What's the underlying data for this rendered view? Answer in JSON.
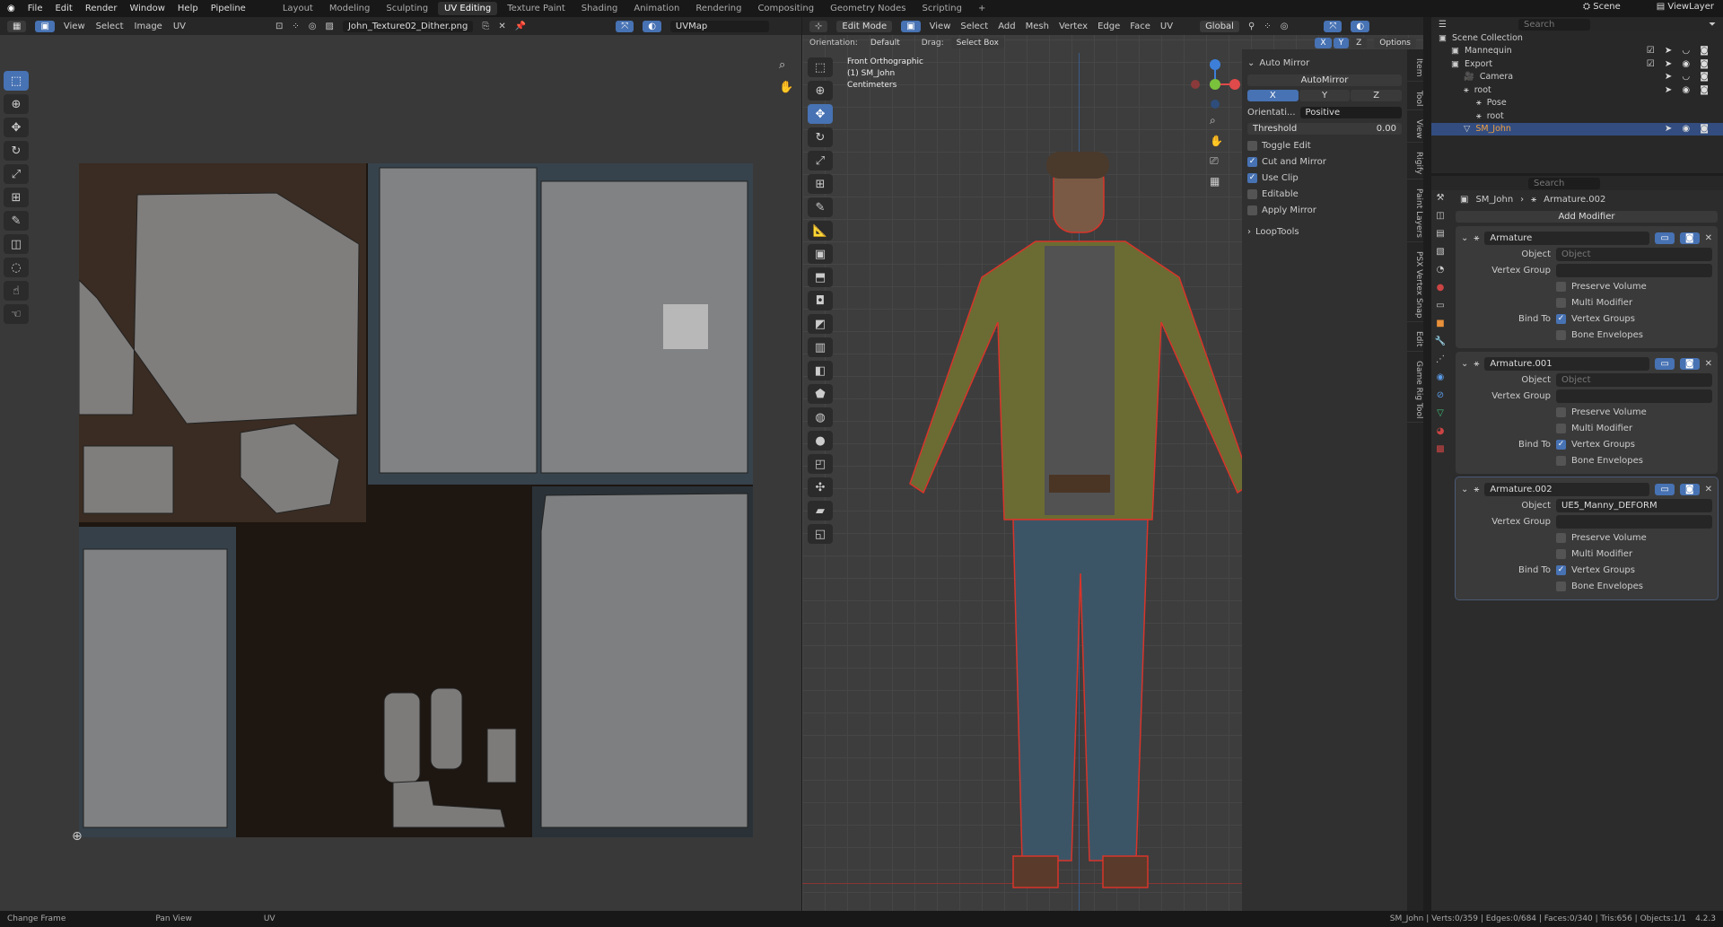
{
  "menu": [
    "File",
    "Edit",
    "Render",
    "Window",
    "Help",
    "Pipeline"
  ],
  "workspaces": [
    "Layout",
    "Modeling",
    "Sculpting",
    "UV Editing",
    "Texture Paint",
    "Shading",
    "Animation",
    "Rendering",
    "Compositing",
    "Geometry Nodes",
    "Scripting",
    "+"
  ],
  "active_workspace": "UV Editing",
  "scene": {
    "scene_label": "Scene",
    "view_layer_label": "ViewLayer"
  },
  "uv_header": {
    "menus": [
      "View",
      "Select",
      "Image",
      "UV"
    ],
    "image_name": "John_Texture02_Dither.png",
    "uv_map": "UVMap"
  },
  "vp_header": {
    "mode": "Edit Mode",
    "menus": [
      "View",
      "Select",
      "Add",
      "Mesh",
      "Vertex",
      "Edge",
      "Face",
      "UV"
    ],
    "transform": "Global",
    "orientation_label": "Orientation:",
    "orientation": "Default",
    "drag_label": "Drag:",
    "drag": "Select Box",
    "axes": [
      "X",
      "Y",
      "Z"
    ],
    "options": "Options"
  },
  "viewport_info": {
    "view": "Front Orthographic",
    "object": "(1) SM_John",
    "units": "Centimeters"
  },
  "npanel": {
    "auto_mirror_title": "Auto Mirror",
    "automirror_button": "AutoMirror",
    "axes": [
      "X",
      "Y",
      "Z"
    ],
    "orientation_label": "Orientati...",
    "orientation_value": "Positive",
    "threshold_label": "Threshold",
    "threshold_value": "0.00",
    "options": [
      {
        "label": "Toggle Edit",
        "checked": false
      },
      {
        "label": "Cut and Mirror",
        "checked": true
      },
      {
        "label": "Use Clip",
        "checked": true
      },
      {
        "label": "Editable",
        "checked": false
      },
      {
        "label": "Apply Mirror",
        "checked": false
      }
    ],
    "looptools_title": "LoopTools"
  },
  "side_tabs": [
    "Item",
    "Tool",
    "View",
    "Rigify",
    "Paint Layers",
    "PSX Vertex Snap",
    "Edit",
    "Game Rig Tool"
  ],
  "outliner": {
    "search_placeholder": "Search",
    "items": [
      {
        "label": "Scene Collection",
        "indent": 0,
        "vis": ""
      },
      {
        "label": "Mannequin",
        "indent": 1,
        "vis": "☑ ➤ ◡ ◙"
      },
      {
        "label": "Export",
        "indent": 1,
        "vis": "☑ ➤ ◉ ◙"
      },
      {
        "label": "Camera",
        "indent": 2,
        "vis": "➤ ◡ ◙"
      },
      {
        "label": "root",
        "indent": 2,
        "vis": "➤ ◉ ◙"
      },
      {
        "label": "Pose",
        "indent": 3,
        "vis": ""
      },
      {
        "label": "root",
        "indent": 3,
        "vis": ""
      },
      {
        "label": "SM_John",
        "indent": 2,
        "vis": "➤ ◉ ◙",
        "selected": true
      }
    ]
  },
  "properties": {
    "search_placeholder": "Search",
    "breadcrumb": [
      "SM_John",
      "Armature.002"
    ],
    "add_modifier": "Add Modifier",
    "modifiers": [
      {
        "name": "Armature",
        "object_label": "Object",
        "object": "Object",
        "object_set": false,
        "vg_label": "Vertex Group",
        "preserve_volume": "Preserve Volume",
        "multi_modifier": "Multi Modifier",
        "bind_label": "Bind To",
        "vertex_groups": "Vertex Groups",
        "bone_envelopes": "Bone Envelopes"
      },
      {
        "name": "Armature.001",
        "object_label": "Object",
        "object": "Object",
        "object_set": false,
        "vg_label": "Vertex Group",
        "preserve_volume": "Preserve Volume",
        "multi_modifier": "Multi Modifier",
        "bind_label": "Bind To",
        "vertex_groups": "Vertex Groups",
        "bone_envelopes": "Bone Envelopes"
      },
      {
        "name": "Armature.002",
        "object_label": "Object",
        "object": "UE5_Manny_DEFORM",
        "object_set": true,
        "vg_label": "Vertex Group",
        "preserve_volume": "Preserve Volume",
        "multi_modifier": "Multi Modifier",
        "bind_label": "Bind To",
        "vertex_groups": "Vertex Groups",
        "bone_envelopes": "Bone Envelopes",
        "active": true
      }
    ]
  },
  "status": {
    "left": [
      "Change Frame",
      "Pan View",
      "UV"
    ],
    "stats": "SM_John | Verts:0/359 | Edges:0/684 | Faces:0/340 | Tris:656 | Objects:1/1",
    "version": "4.2.3"
  },
  "colors": {
    "accent": "#4772b3",
    "selection": "#334d80",
    "edge_red": "#d8342a"
  }
}
